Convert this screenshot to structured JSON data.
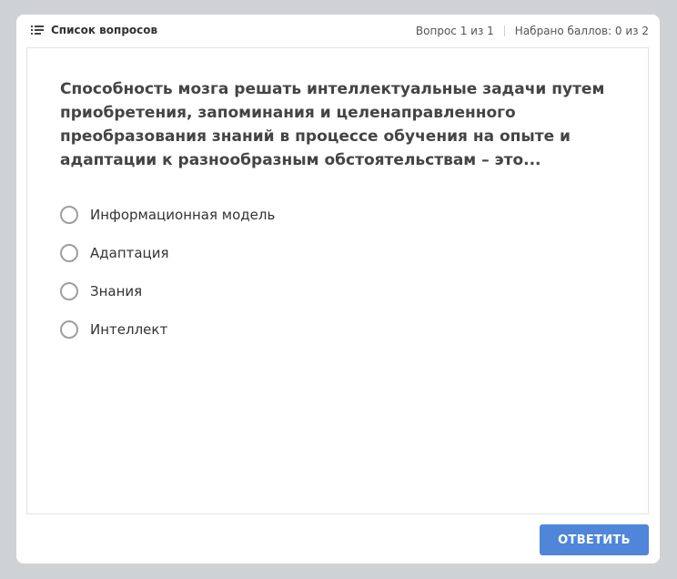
{
  "header": {
    "question_list_label": "Список вопросов",
    "question_counter": "Вопрос 1 из 1",
    "score": "Набрано баллов: 0 из 2"
  },
  "question": {
    "text": "Способность мозга решать интеллектуальные задачи путем приобретения, запоминания и целенаправленного преобразования знаний в процессе обучения на опыте и адаптации к разнообразным обстоятельствам – это..."
  },
  "options": [
    {
      "label": "Информационная модель",
      "selected": false
    },
    {
      "label": "Адаптация",
      "selected": false
    },
    {
      "label": "Знания",
      "selected": false
    },
    {
      "label": "Интеллект",
      "selected": false
    }
  ],
  "footer": {
    "answer_label": "ОТВЕТИТЬ"
  },
  "colors": {
    "page_background": "#cfd2d4",
    "button": "#4f86d9",
    "radio_border": "#9e9e9e"
  },
  "icons": {
    "question_list": "list-icon",
    "option": "radio-icon"
  }
}
